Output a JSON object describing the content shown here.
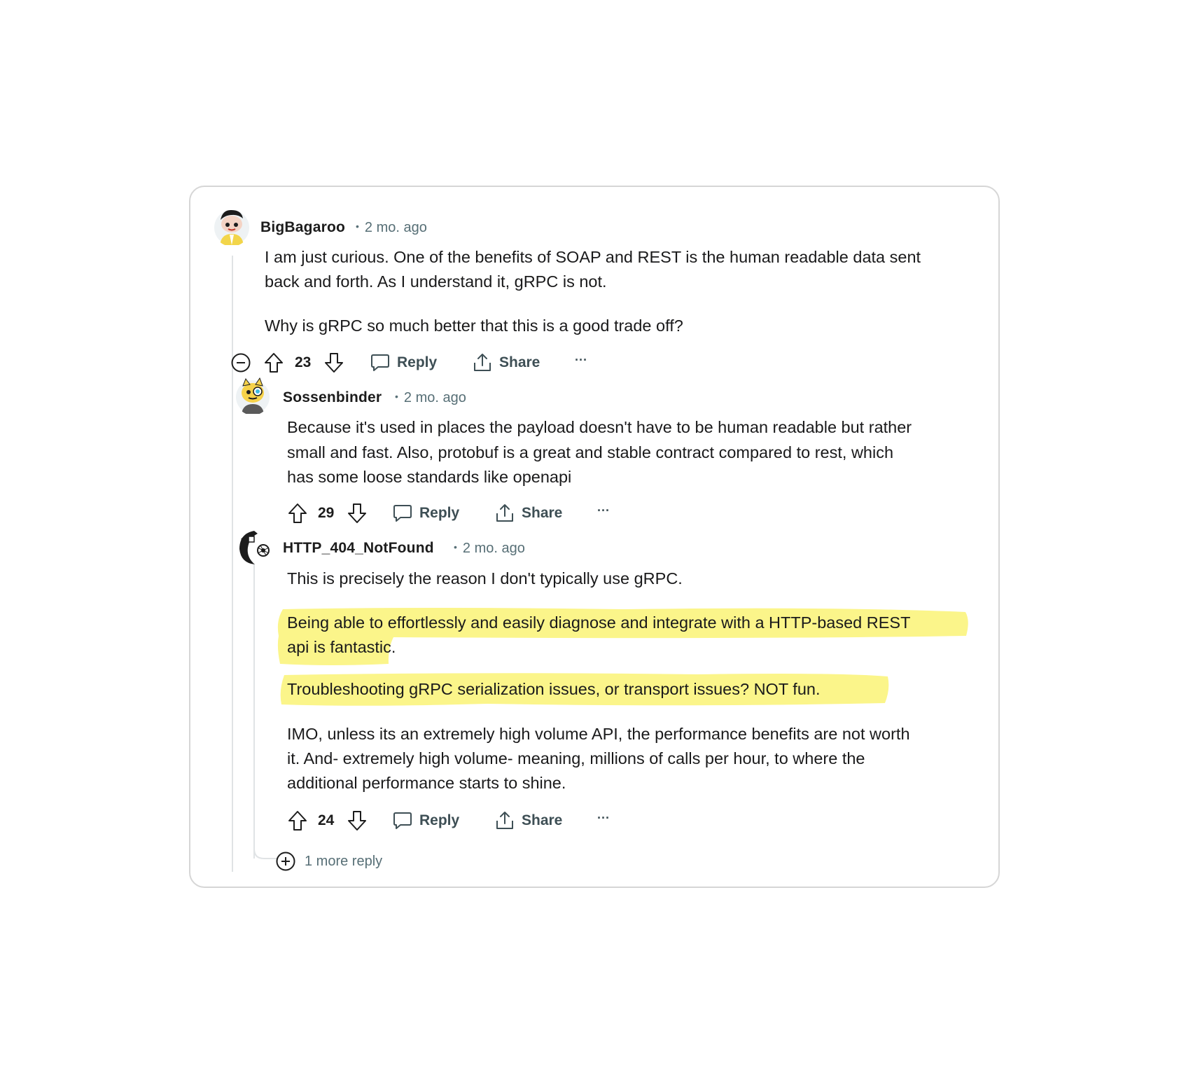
{
  "highlight_color": "#fbf58a",
  "comments": [
    {
      "username": "BigBagaroo",
      "time": "2 mo. ago",
      "avatar_icon": "snoo-avatar-icon",
      "paragraphs": [
        "I am just curious. One of the benefits of SOAP and REST is the human readable data sent",
        "back and forth. As I understand it, gRPC is not.",
        "Why is gRPC so much better that this is a good trade off?"
      ],
      "votes": "23",
      "reply_label": "Reply",
      "share_label": "Share",
      "more_label": "···"
    },
    {
      "username": "Sossenbinder",
      "time": "2 mo. ago",
      "avatar_icon": "snoo-avatar-icon",
      "paragraphs": [
        "Because it's used in places the payload doesn't have to be human readable but rather",
        "small and fast. Also, protobuf is a great and stable contract compared to rest, which",
        "has some loose standards like openapi"
      ],
      "votes": "29",
      "reply_label": "Reply",
      "share_label": "Share",
      "more_label": "···"
    },
    {
      "username": "HTTP_404_NotFound",
      "time": "2 mo. ago",
      "avatar_icon": "snoo-avatar-icon",
      "paragraphs": [
        "This is precisely the reason I don't typically use gRPC.",
        "Being able to effortlessly and easily diagnose and integrate with a HTTP-based REST",
        "api is fantastic.",
        "Troubleshooting gRPC serialization issues, or transport issues? NOT fun.",
        "IMO, unless its an extremely high volume API, the performance benefits are not worth",
        "it. And- extremely high volume- meaning, millions of calls per hour, to where the",
        "additional performance starts to shine."
      ],
      "votes": "24",
      "reply_label": "Reply",
      "share_label": "Share",
      "more_label": "···"
    }
  ],
  "more_replies_label": "1 more reply"
}
